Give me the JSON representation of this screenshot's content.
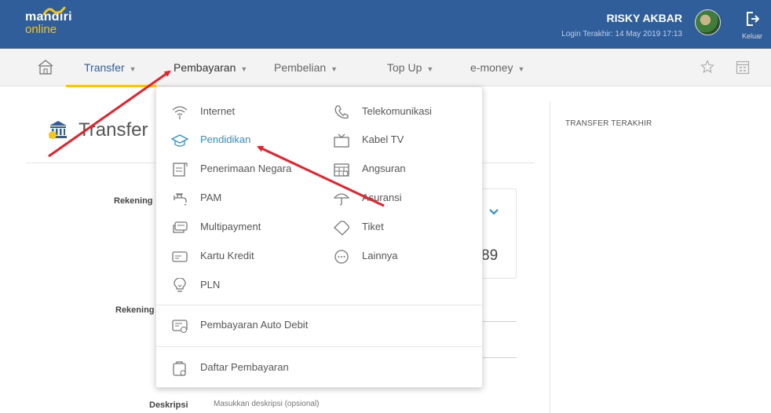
{
  "header": {
    "logo_line1": "mandiri",
    "logo_line2": "online",
    "user_name": "RISKY AKBAR",
    "last_login": "Login Terakhir: 14 May 2019 17:13",
    "logout_label": "Keluar"
  },
  "nav": {
    "items": [
      {
        "label": "Transfer"
      },
      {
        "label": "Pembayaran"
      },
      {
        "label": "Pembelian"
      },
      {
        "label": "Top Up"
      },
      {
        "label": "e-money"
      }
    ]
  },
  "main": {
    "title": "Transfer",
    "sidebar_title": "TRANSFER TERAKHIR",
    "label_rekening_1": "Rekening",
    "label_rekening_2": "Rekening",
    "card_number_tail": "89",
    "desc_label": "Deskripsi",
    "desc_placeholder": "Masukkan deskripsi (opsional)"
  },
  "dropdown": {
    "left_col": [
      {
        "label": "Internet",
        "icon": "wifi-icon"
      },
      {
        "label": "Pendidikan",
        "icon": "graduation-cap-icon"
      },
      {
        "label": "Penerimaan Negara",
        "icon": "document-icon"
      },
      {
        "label": "PAM",
        "icon": "water-tap-icon"
      },
      {
        "label": "Multipayment",
        "icon": "multipayment-icon"
      },
      {
        "label": "Kartu Kredit",
        "icon": "credit-card-icon"
      },
      {
        "label": "PLN",
        "icon": "lightbulb-icon"
      }
    ],
    "right_col": [
      {
        "label": "Telekomunikasi",
        "icon": "phone-icon"
      },
      {
        "label": "Kabel TV",
        "icon": "tv-icon"
      },
      {
        "label": "Angsuran",
        "icon": "calendar-icon"
      },
      {
        "label": "Asuransi",
        "icon": "umbrella-icon"
      },
      {
        "label": "Tiket",
        "icon": "ticket-icon"
      },
      {
        "label": "Lainnya",
        "icon": "more-icon"
      }
    ],
    "auto_debit": "Pembayaran Auto Debit",
    "daftar": "Daftar Pembayaran"
  },
  "colors": {
    "header_bg": "#2f5e9a",
    "accent_yellow": "#f5c518",
    "link_blue": "#2f8fd4",
    "annotation_red": "#e8202a"
  }
}
